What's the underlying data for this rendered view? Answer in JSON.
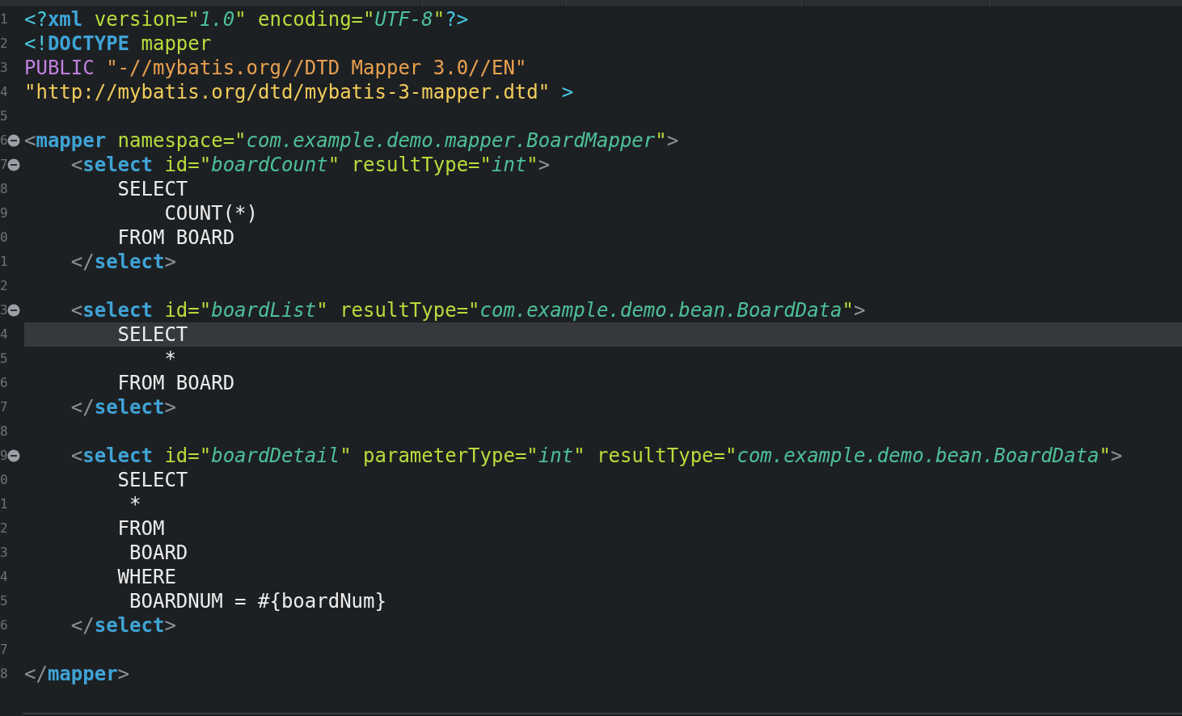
{
  "editor": {
    "lines": [
      {
        "number": "1",
        "fold": false,
        "current": false,
        "tokens": [
          {
            "kind": "decl",
            "text": "<?"
          },
          {
            "kind": "tag",
            "text": "xml"
          },
          {
            "kind": "attr",
            "text": " version=\""
          },
          {
            "kind": "value",
            "text": "1.0"
          },
          {
            "kind": "attr",
            "text": "\" encoding=\""
          },
          {
            "kind": "value",
            "text": "UTF-8"
          },
          {
            "kind": "attr",
            "text": "\""
          },
          {
            "kind": "decl",
            "text": "?>"
          }
        ]
      },
      {
        "number": "2",
        "fold": false,
        "current": false,
        "tokens": [
          {
            "kind": "decl",
            "text": "<!"
          },
          {
            "kind": "tag",
            "text": "DOCTYPE"
          },
          {
            "kind": "attr",
            "text": " mapper"
          }
        ]
      },
      {
        "number": "3",
        "fold": false,
        "current": false,
        "tokens": [
          {
            "kind": "keyword",
            "text": "PUBLIC"
          },
          {
            "kind": "string",
            "text": " \"-//mybatis.org//DTD Mapper 3.0//EN\""
          }
        ]
      },
      {
        "number": "4",
        "fold": false,
        "current": false,
        "tokens": [
          {
            "kind": "url",
            "text": "\"http://mybatis.org/dtd/mybatis-3-mapper.dtd\""
          },
          {
            "kind": "decl",
            "text": " >"
          }
        ]
      },
      {
        "number": "5",
        "fold": false,
        "current": false
      },
      {
        "number": "6",
        "fold": true,
        "current": false,
        "tokens": [
          {
            "kind": "punct",
            "text": "<"
          },
          {
            "kind": "tag",
            "text": "mapper"
          },
          {
            "kind": "attr",
            "text": " namespace=\""
          },
          {
            "kind": "value",
            "text": "com.example.demo.mapper.BoardMapper"
          },
          {
            "kind": "attr",
            "text": "\""
          },
          {
            "kind": "punct",
            "text": ">"
          }
        ]
      },
      {
        "number": "7",
        "fold": true,
        "current": false,
        "tokens": [
          {
            "kind": "punct",
            "text": "    <"
          },
          {
            "kind": "tag",
            "text": "select"
          },
          {
            "kind": "attr",
            "text": " id=\""
          },
          {
            "kind": "value",
            "text": "boardCount"
          },
          {
            "kind": "attr",
            "text": "\" resultType=\""
          },
          {
            "kind": "value",
            "text": "int"
          },
          {
            "kind": "attr",
            "text": "\""
          },
          {
            "kind": "punct",
            "text": ">"
          }
        ]
      },
      {
        "number": "8",
        "fold": false,
        "current": false,
        "tokens": [
          {
            "kind": "text",
            "text": "        SELECT"
          }
        ]
      },
      {
        "number": "9",
        "fold": false,
        "current": false,
        "tokens": [
          {
            "kind": "text",
            "text": "            COUNT(*)"
          }
        ]
      },
      {
        "number": "0",
        "fold": false,
        "current": false,
        "tokens": [
          {
            "kind": "text",
            "text": "        FROM BOARD"
          }
        ]
      },
      {
        "number": "1",
        "fold": false,
        "current": false,
        "tokens": [
          {
            "kind": "punct",
            "text": "    </"
          },
          {
            "kind": "tag",
            "text": "select"
          },
          {
            "kind": "punct",
            "text": ">"
          }
        ]
      },
      {
        "number": "2",
        "fold": false,
        "current": false
      },
      {
        "number": "3",
        "fold": true,
        "current": false,
        "tokens": [
          {
            "kind": "punct",
            "text": "    <"
          },
          {
            "kind": "tag",
            "text": "select"
          },
          {
            "kind": "attr",
            "text": " id=\""
          },
          {
            "kind": "value",
            "text": "boardList"
          },
          {
            "kind": "attr",
            "text": "\" resultType=\""
          },
          {
            "kind": "value",
            "text": "com.example.demo.bean.BoardData"
          },
          {
            "kind": "attr",
            "text": "\""
          },
          {
            "kind": "punct",
            "text": ">"
          }
        ]
      },
      {
        "number": "4",
        "fold": false,
        "current": true,
        "tokens": [
          {
            "kind": "text",
            "text": "        SELECT"
          }
        ]
      },
      {
        "number": "5",
        "fold": false,
        "current": false,
        "tokens": [
          {
            "kind": "text",
            "text": "            *"
          }
        ]
      },
      {
        "number": "6",
        "fold": false,
        "current": false,
        "tokens": [
          {
            "kind": "text",
            "text": "        FROM BOARD"
          }
        ]
      },
      {
        "number": "7",
        "fold": false,
        "current": false,
        "tokens": [
          {
            "kind": "punct",
            "text": "    </"
          },
          {
            "kind": "tag",
            "text": "select"
          },
          {
            "kind": "punct",
            "text": ">"
          }
        ]
      },
      {
        "number": "8",
        "fold": false,
        "current": false
      },
      {
        "number": "9",
        "fold": true,
        "current": false,
        "tokens": [
          {
            "kind": "punct",
            "text": "    <"
          },
          {
            "kind": "tag",
            "text": "select"
          },
          {
            "kind": "attr",
            "text": " id=\""
          },
          {
            "kind": "value",
            "text": "boardDetail"
          },
          {
            "kind": "attr",
            "text": "\" parameterType=\""
          },
          {
            "kind": "value",
            "text": "int"
          },
          {
            "kind": "attr",
            "text": "\" resultType=\""
          },
          {
            "kind": "value",
            "text": "com.example.demo.bean.BoardData"
          },
          {
            "kind": "attr",
            "text": "\""
          },
          {
            "kind": "punct",
            "text": ">"
          }
        ]
      },
      {
        "number": "0",
        "fold": false,
        "current": false,
        "tokens": [
          {
            "kind": "text",
            "text": "        SELECT"
          }
        ]
      },
      {
        "number": "1",
        "fold": false,
        "current": false,
        "tokens": [
          {
            "kind": "text",
            "text": "         *"
          }
        ]
      },
      {
        "number": "2",
        "fold": false,
        "current": false,
        "tokens": [
          {
            "kind": "text",
            "text": "        FROM"
          }
        ]
      },
      {
        "number": "3",
        "fold": false,
        "current": false,
        "tokens": [
          {
            "kind": "text",
            "text": "         BOARD"
          }
        ]
      },
      {
        "number": "4",
        "fold": false,
        "current": false,
        "tokens": [
          {
            "kind": "text",
            "text": "        WHERE"
          }
        ]
      },
      {
        "number": "5",
        "fold": false,
        "current": false,
        "tokens": [
          {
            "kind": "text",
            "text": "         BOARDNUM = #{boardNum}"
          }
        ]
      },
      {
        "number": "6",
        "fold": false,
        "current": false,
        "tokens": [
          {
            "kind": "punct",
            "text": "    </"
          },
          {
            "kind": "tag",
            "text": "select"
          },
          {
            "kind": "punct",
            "text": ">"
          }
        ]
      },
      {
        "number": "7",
        "fold": false,
        "current": false
      },
      {
        "number": "8",
        "fold": false,
        "current": false,
        "tokens": [
          {
            "kind": "punct",
            "text": "</"
          },
          {
            "kind": "tag",
            "text": "mapper"
          },
          {
            "kind": "punct",
            "text": ">"
          }
        ]
      }
    ]
  }
}
